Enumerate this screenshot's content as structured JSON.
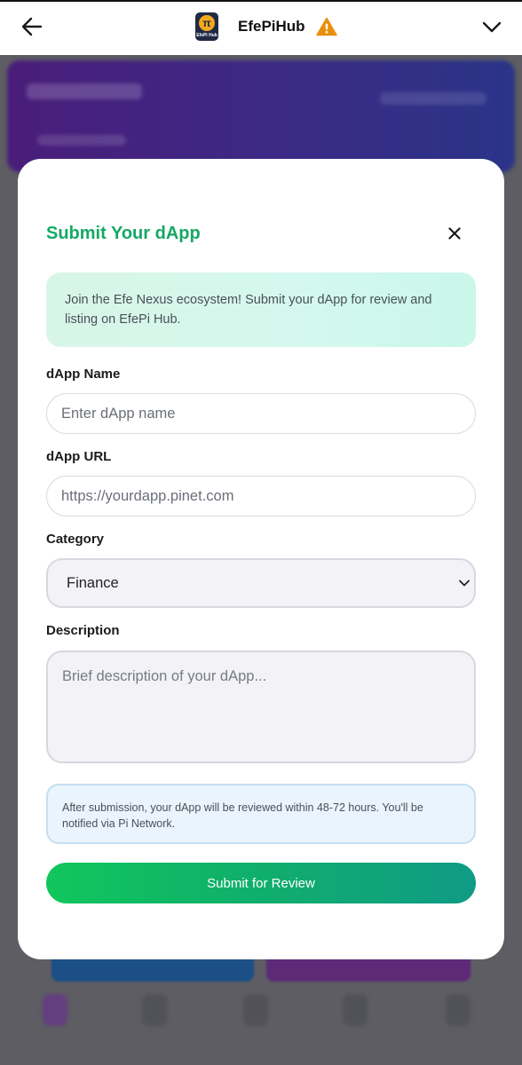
{
  "header": {
    "app_title": "EfePiHub",
    "logo_text": "EfePi Hub",
    "logo_symbol": "π",
    "icons": {
      "back": "arrow-left-icon",
      "warning": "warning-triangle-icon",
      "dropdown": "chevron-down-icon"
    }
  },
  "modal": {
    "title": "Submit Your dApp",
    "close_icon": "close-icon",
    "intro_text": "Join the Efe Nexus ecosystem! Submit your dApp for review and listing on EfePi Hub.",
    "fields": {
      "name": {
        "label": "dApp Name",
        "placeholder": "Enter dApp name",
        "value": ""
      },
      "url": {
        "label": "dApp URL",
        "placeholder": "https://yourdapp.pinet.com",
        "value": ""
      },
      "category": {
        "label": "Category",
        "selected": "Finance"
      },
      "description": {
        "label": "Description",
        "placeholder": "Brief description of your dApp...",
        "value": ""
      }
    },
    "notice_text": "After submission, your dApp will be reviewed within 48-72 hours. You'll be notified via Pi Network.",
    "submit_label": "Submit for Review"
  },
  "colors": {
    "accent_green": "#16a865",
    "button_gradient_start": "#11c65c",
    "button_gradient_end": "#0f9b85",
    "warning_orange": "#e8900c",
    "overlay": "#5d5d63"
  }
}
